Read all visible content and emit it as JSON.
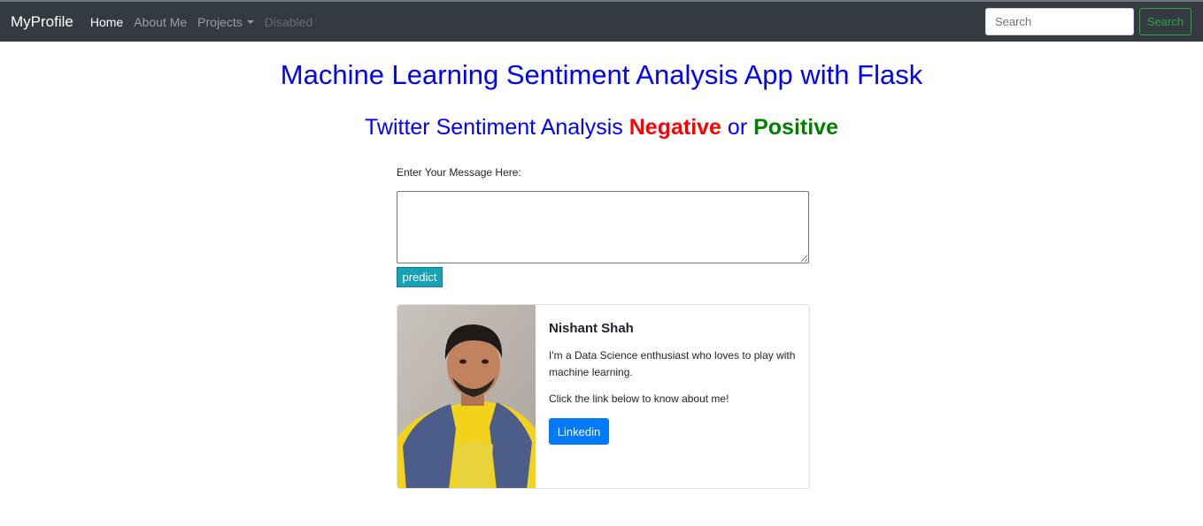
{
  "navbar": {
    "brand": "MyProfile",
    "links": [
      {
        "label": "Home",
        "state": "active"
      },
      {
        "label": "About Me",
        "state": "normal"
      },
      {
        "label": "Projects",
        "state": "dropdown"
      },
      {
        "label": "Disabled",
        "state": "disabled"
      }
    ],
    "search_placeholder": "Search",
    "search_button": "Search"
  },
  "main": {
    "title": "Machine Learning Sentiment Analysis App with Flask",
    "subtitle_prefix": "Twitter Sentiment Analysis",
    "subtitle_negative": "Negative",
    "subtitle_or": "or",
    "subtitle_positive": "Positive",
    "message_label": "Enter Your Message Here:",
    "message_value": "",
    "predict_button": "predict"
  },
  "profile": {
    "name": "Nishant Shah",
    "bio": "I'm a Data Science enthusiast who loves to play with machine learning.",
    "cta_text": "Click the link below to know about me!",
    "link_button": "Linkedin"
  },
  "colors": {
    "navbar_bg": "#343a40",
    "title": "#0000ff",
    "negative": "#ff0000",
    "positive": "#008000",
    "predict": "#17a2b8",
    "linkedin": "#007bff",
    "search_button": "#28a745"
  }
}
